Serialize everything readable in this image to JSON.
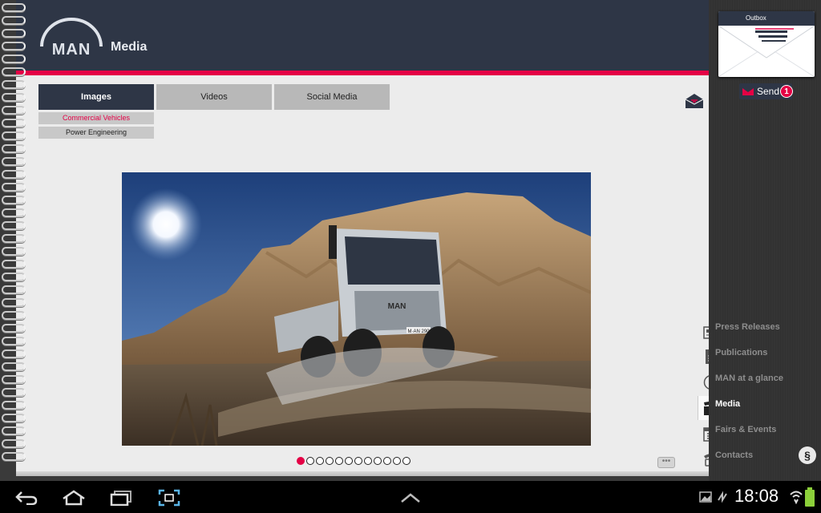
{
  "header": {
    "title": "Media",
    "logo_text": "MAN"
  },
  "tabs": [
    {
      "label": "Images",
      "active": true
    },
    {
      "label": "Videos",
      "active": false
    },
    {
      "label": "Social Media",
      "active": false
    }
  ],
  "subtabs": [
    {
      "label": "Commercial Vehicles",
      "active": true
    },
    {
      "label": "Power Engineering",
      "active": false
    }
  ],
  "gallery": {
    "current_page": 1,
    "total_pages": 12,
    "plate_text": "M·AN 290"
  },
  "outbox": {
    "title": "Outbox",
    "send_label": "Send",
    "send_count": "1"
  },
  "menu": {
    "items": [
      {
        "label": "Press Releases",
        "icon": "press-icon"
      },
      {
        "label": "Publications",
        "icon": "document-icon"
      },
      {
        "label": "MAN at a glance",
        "icon": "info-icon"
      },
      {
        "label": "Media",
        "icon": "clapper-icon",
        "active": true
      },
      {
        "label": "Fairs & Events",
        "icon": "calendar-icon"
      },
      {
        "label": "Contacts",
        "icon": "phone-icon"
      }
    ],
    "legal_symbol": "§"
  },
  "more_label": "•••",
  "status": {
    "time": "18:08"
  },
  "colors": {
    "accent": "#e40045",
    "navy": "#2e3646"
  }
}
